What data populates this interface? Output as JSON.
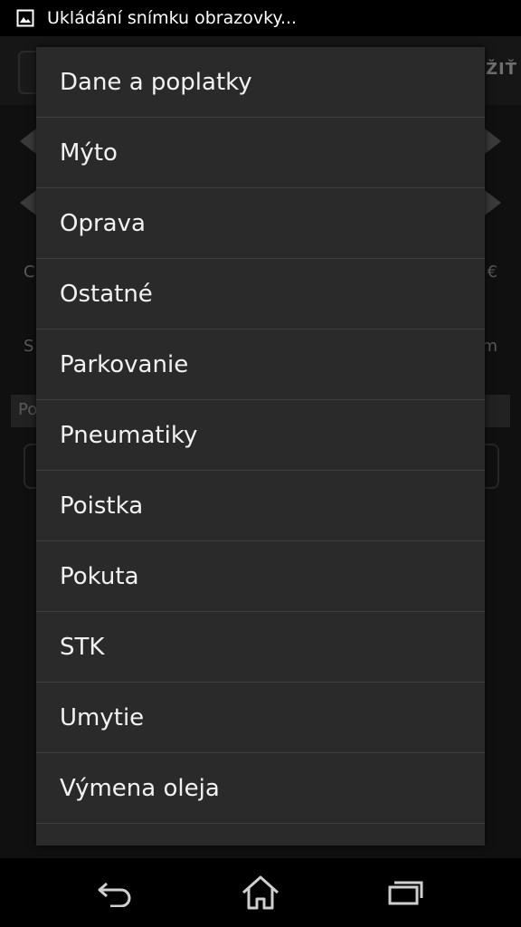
{
  "status_bar": {
    "notification_icon": "image-icon",
    "text": "Ukládání snímku obrazovky..."
  },
  "background_app": {
    "save_action_partial": "OŽIŤ",
    "partial_labels": [
      "C",
      "S",
      "Po"
    ],
    "partial_values": [
      "€",
      "m"
    ]
  },
  "dropdown": {
    "items": [
      {
        "label": "Dane a poplatky"
      },
      {
        "label": "Mýto"
      },
      {
        "label": "Oprava"
      },
      {
        "label": "Ostatné"
      },
      {
        "label": "Parkovanie"
      },
      {
        "label": "Pneumatiky"
      },
      {
        "label": "Poistka"
      },
      {
        "label": "Pokuta"
      },
      {
        "label": "STK"
      },
      {
        "label": "Umytie"
      },
      {
        "label": "Výmena oleja"
      },
      {
        "label": ""
      }
    ]
  },
  "nav_bar": {
    "back_icon": "back-icon",
    "home_icon": "home-icon",
    "recents_icon": "recent-apps-icon"
  },
  "colors": {
    "dropdown_bg": "#2a2a2a",
    "divider": "#3f3f3f",
    "text": "#f2f2f2",
    "bars": "#000000"
  }
}
